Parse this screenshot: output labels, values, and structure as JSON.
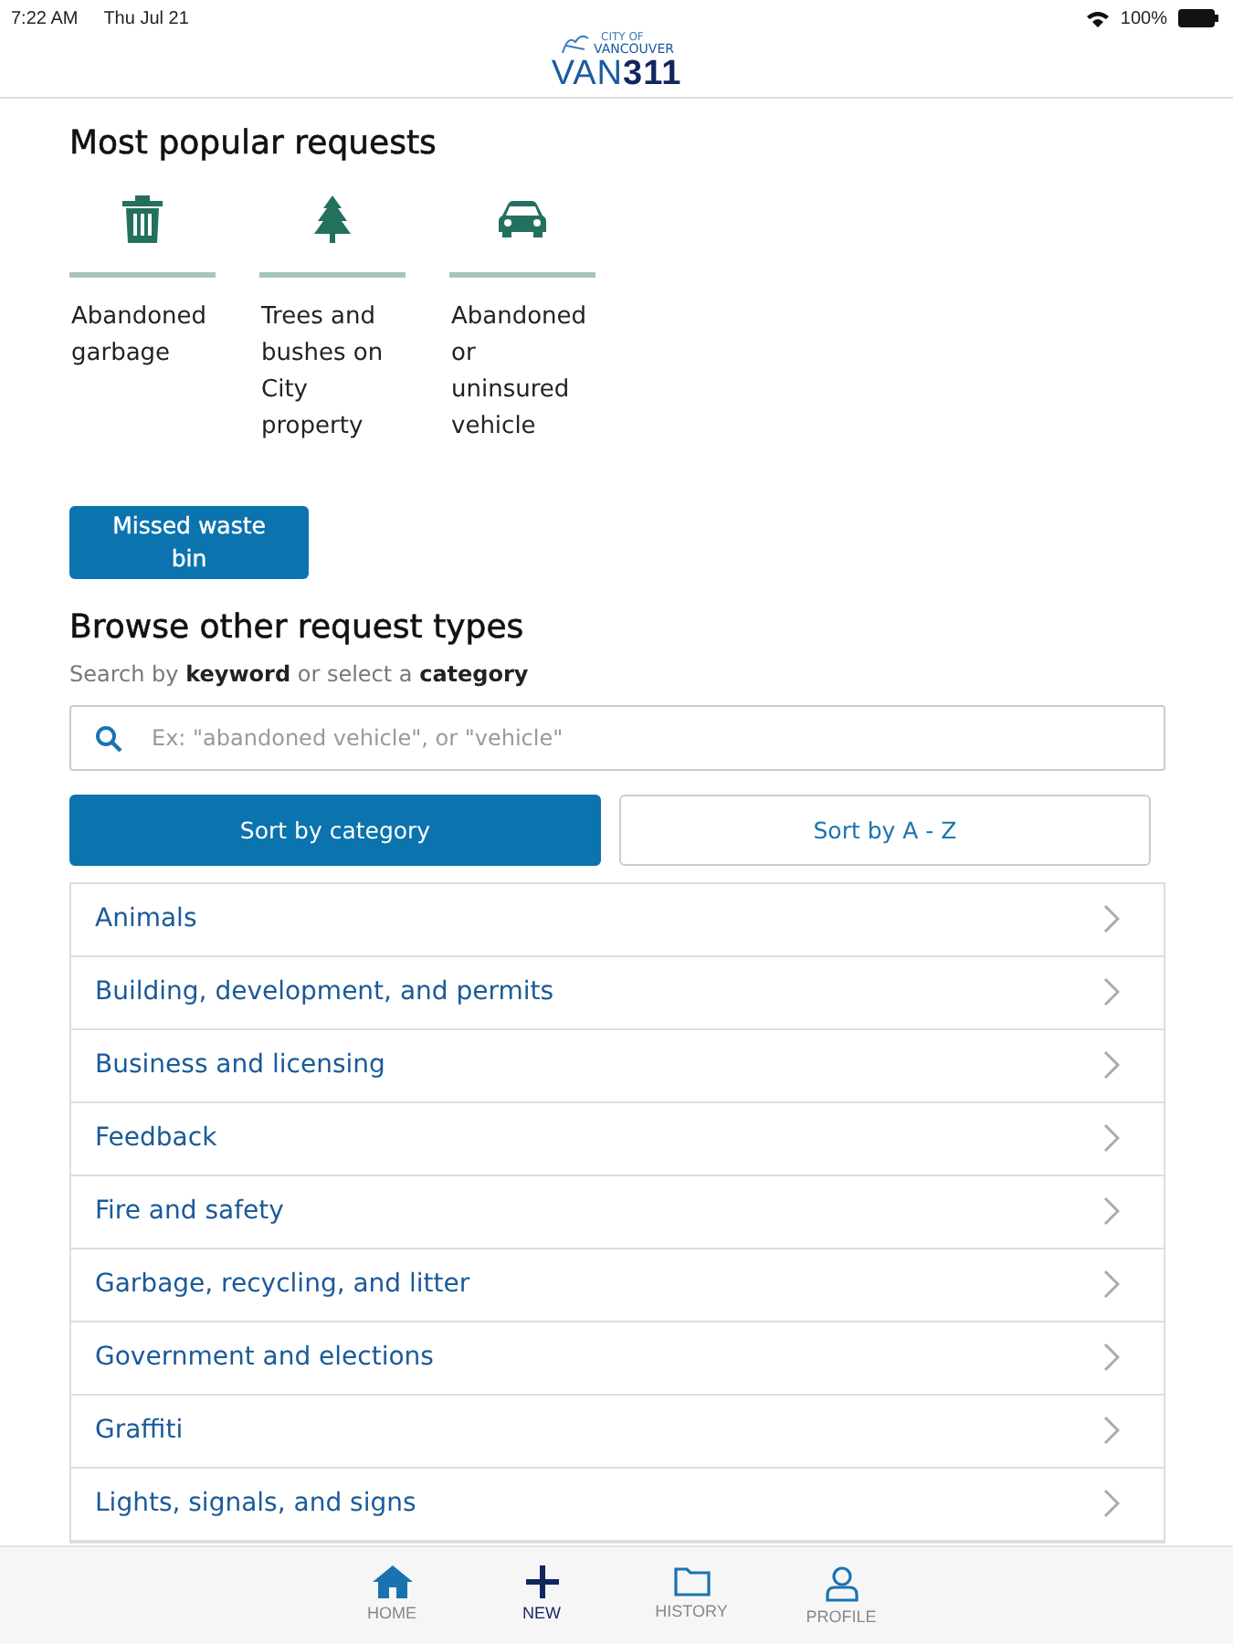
{
  "status_bar": {
    "time": "7:22 AM",
    "date": "Thu Jul 21",
    "battery": "100%"
  },
  "header": {
    "logo_small_1": "CITY OF",
    "logo_small_2": "VANCOUVER",
    "logo_main": "VAN**311**"
  },
  "popular": {
    "title": "Most popular requests",
    "items": [
      {
        "kind": "trash",
        "label": "Abandoned garbage"
      },
      {
        "kind": "tree",
        "label": "Trees and bushes on City property"
      },
      {
        "kind": "car",
        "label": "Abandoned or uninsured vehicle"
      }
    ],
    "button": "Missed waste bin"
  },
  "browse": {
    "title": "Browse other request types",
    "hint": "Search by **keyword** or select a **category**",
    "search": {
      "placeholder": "Ex: \"abandoned vehicle\", or \"vehicle\""
    },
    "sort_tabs": [
      {
        "label": "Sort by category",
        "selected": true
      },
      {
        "label": "Sort by A - Z",
        "selected": false
      }
    ],
    "categories": [
      "Animals",
      "Building, development, and permits",
      "Business and licensing",
      "Feedback",
      "Fire and safety",
      "Garbage, recycling, and litter",
      "Government and elections",
      "Graffiti",
      "Lights, signals, and signs"
    ]
  },
  "tab_bar": [
    {
      "kind": "home",
      "label": "HOME",
      "selected": false
    },
    {
      "kind": "new",
      "label": "NEW",
      "selected": true
    },
    {
      "kind": "history",
      "label": "HISTORY",
      "selected": false
    },
    {
      "kind": "profile",
      "label": "PROFILE",
      "selected": false
    }
  ]
}
